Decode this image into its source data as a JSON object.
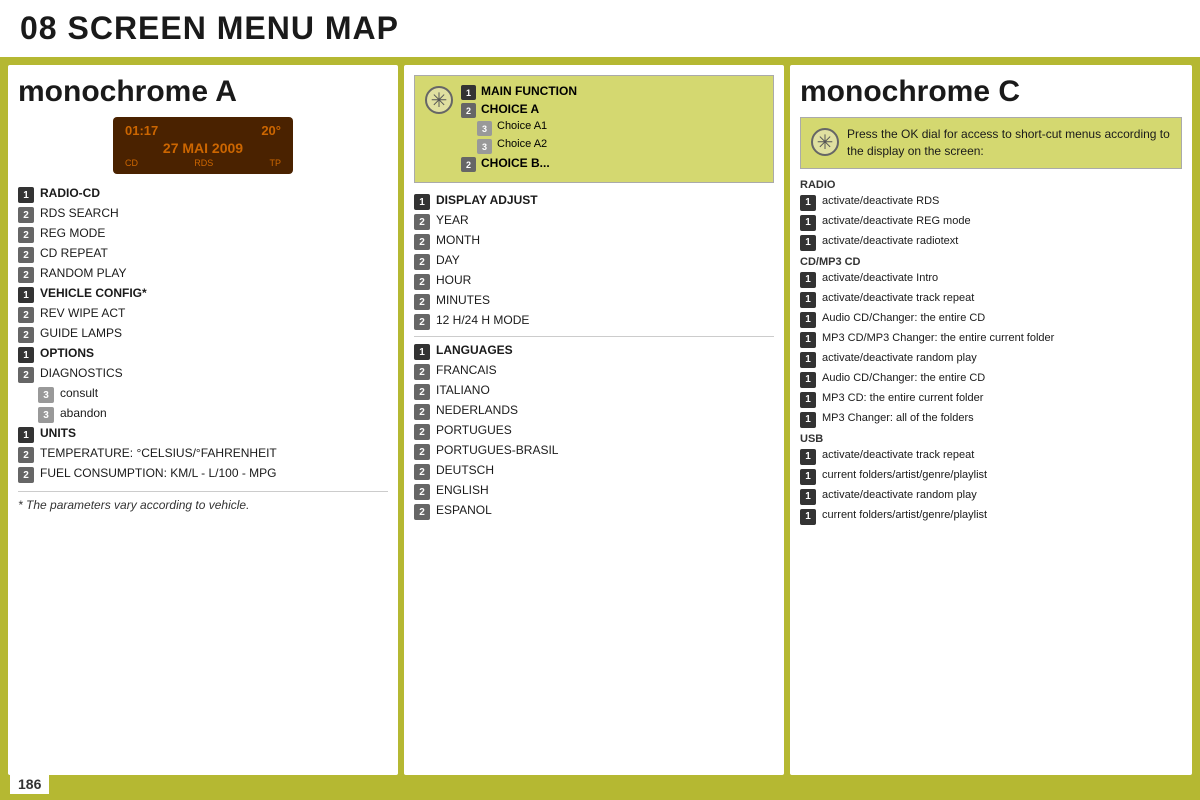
{
  "header": {
    "title": "08 SCREEN MENU MAP"
  },
  "left_panel": {
    "title": "monochrome A",
    "display": {
      "time_left": "01:17",
      "time_right": "20°",
      "date": "27 MAI 2009",
      "bottom_left": "CD",
      "bottom_mid": "RDS",
      "bottom_right": "TP"
    },
    "items": [
      {
        "badge": "1",
        "text": "RADIO-CD",
        "level": 1
      },
      {
        "badge": "2",
        "text": "RDS SEARCH",
        "level": 2
      },
      {
        "badge": "2",
        "text": "REG MODE",
        "level": 2
      },
      {
        "badge": "2",
        "text": "CD REPEAT",
        "level": 2
      },
      {
        "badge": "2",
        "text": "RANDOM PLAY",
        "level": 2
      },
      {
        "badge": "1",
        "text": "VEHICLE CONFIG*",
        "level": 1
      },
      {
        "badge": "2",
        "text": "REV WIPE ACT",
        "level": 2
      },
      {
        "badge": "2",
        "text": "GUIDE LAMPS",
        "level": 2
      },
      {
        "badge": "1",
        "text": "OPTIONS",
        "level": 1
      },
      {
        "badge": "2",
        "text": "DIAGNOSTICS",
        "level": 2
      },
      {
        "badge": "3",
        "text": "consult",
        "level": 3
      },
      {
        "badge": "3",
        "text": "abandon",
        "level": 3
      },
      {
        "badge": "1",
        "text": "UNITS",
        "level": 1
      },
      {
        "badge": "2",
        "text": "TEMPERATURE: °CELSIUS/°FAHRENHEIT",
        "level": 2
      },
      {
        "badge": "2",
        "text": "FUEL CONSUMPTION: KM/L - L/100 - MPG",
        "level": 2
      }
    ],
    "footnote": "* The parameters vary according to vehicle."
  },
  "center_panel": {
    "top_menu": {
      "badge1": "1",
      "item1": "MAIN FUNCTION",
      "badge2": "2",
      "item2": "CHOICE A",
      "badge3a": "3",
      "item3a": "Choice A1",
      "badge3b": "3",
      "item3b": "Choice A2",
      "badge2b": "2",
      "item2b": "CHOICE B..."
    },
    "sections": [
      {
        "label": "",
        "items": [
          {
            "badge": "1",
            "text": "DISPLAY ADJUST",
            "level": 1
          },
          {
            "badge": "2",
            "text": "YEAR",
            "level": 2
          },
          {
            "badge": "2",
            "text": "MONTH",
            "level": 2
          },
          {
            "badge": "2",
            "text": "DAY",
            "level": 2
          },
          {
            "badge": "2",
            "text": "HOUR",
            "level": 2
          },
          {
            "badge": "2",
            "text": "MINUTES",
            "level": 2
          },
          {
            "badge": "2",
            "text": "12 H/24 H MODE",
            "level": 2
          }
        ]
      },
      {
        "label": "",
        "items": [
          {
            "badge": "1",
            "text": "LANGUAGES",
            "level": 1
          },
          {
            "badge": "2",
            "text": "FRANCAIS",
            "level": 2
          },
          {
            "badge": "2",
            "text": "ITALIANO",
            "level": 2
          },
          {
            "badge": "2",
            "text": "NEDERLANDS",
            "level": 2
          },
          {
            "badge": "2",
            "text": "PORTUGUES",
            "level": 2
          },
          {
            "badge": "2",
            "text": "PORTUGUES-BRASIL",
            "level": 2
          },
          {
            "badge": "2",
            "text": "DEUTSCH",
            "level": 2
          },
          {
            "badge": "2",
            "text": "ENGLISH",
            "level": 2
          },
          {
            "badge": "2",
            "text": "ESPANOL",
            "level": 2
          }
        ]
      }
    ]
  },
  "right_panel": {
    "title": "monochrome C",
    "top_text": "Press the OK dial for access to short-cut menus according to the display on the screen:",
    "sections": [
      {
        "label": "RADIO",
        "items": [
          {
            "badge": "1",
            "text": "activate/deactivate RDS"
          },
          {
            "badge": "1",
            "text": "activate/deactivate REG mode"
          },
          {
            "badge": "1",
            "text": "activate/deactivate radiotext"
          }
        ]
      },
      {
        "label": "CD/MP3 CD",
        "items": [
          {
            "badge": "1",
            "text": "activate/deactivate Intro"
          },
          {
            "badge": "1",
            "text": "activate/deactivate track repeat"
          },
          {
            "badge": "1",
            "text": "Audio CD/Changer: the entire CD"
          },
          {
            "badge": "1",
            "text": "MP3 CD/MP3 Changer: the entire current folder"
          },
          {
            "badge": "1",
            "text": "activate/deactivate random play"
          },
          {
            "badge": "1",
            "text": "Audio CD/Changer: the entire CD"
          },
          {
            "badge": "1",
            "text": "MP3 CD: the entire current folder"
          },
          {
            "badge": "1",
            "text": "MP3 Changer: all of the folders"
          }
        ]
      },
      {
        "label": "USB",
        "items": [
          {
            "badge": "1",
            "text": "activate/deactivate track repeat"
          },
          {
            "badge": "1",
            "text": "current folders/artist/genre/playlist"
          },
          {
            "badge": "1",
            "text": "activate/deactivate random play"
          },
          {
            "badge": "1",
            "text": "current folders/artist/genre/playlist"
          }
        ]
      }
    ]
  },
  "page_number": "186"
}
